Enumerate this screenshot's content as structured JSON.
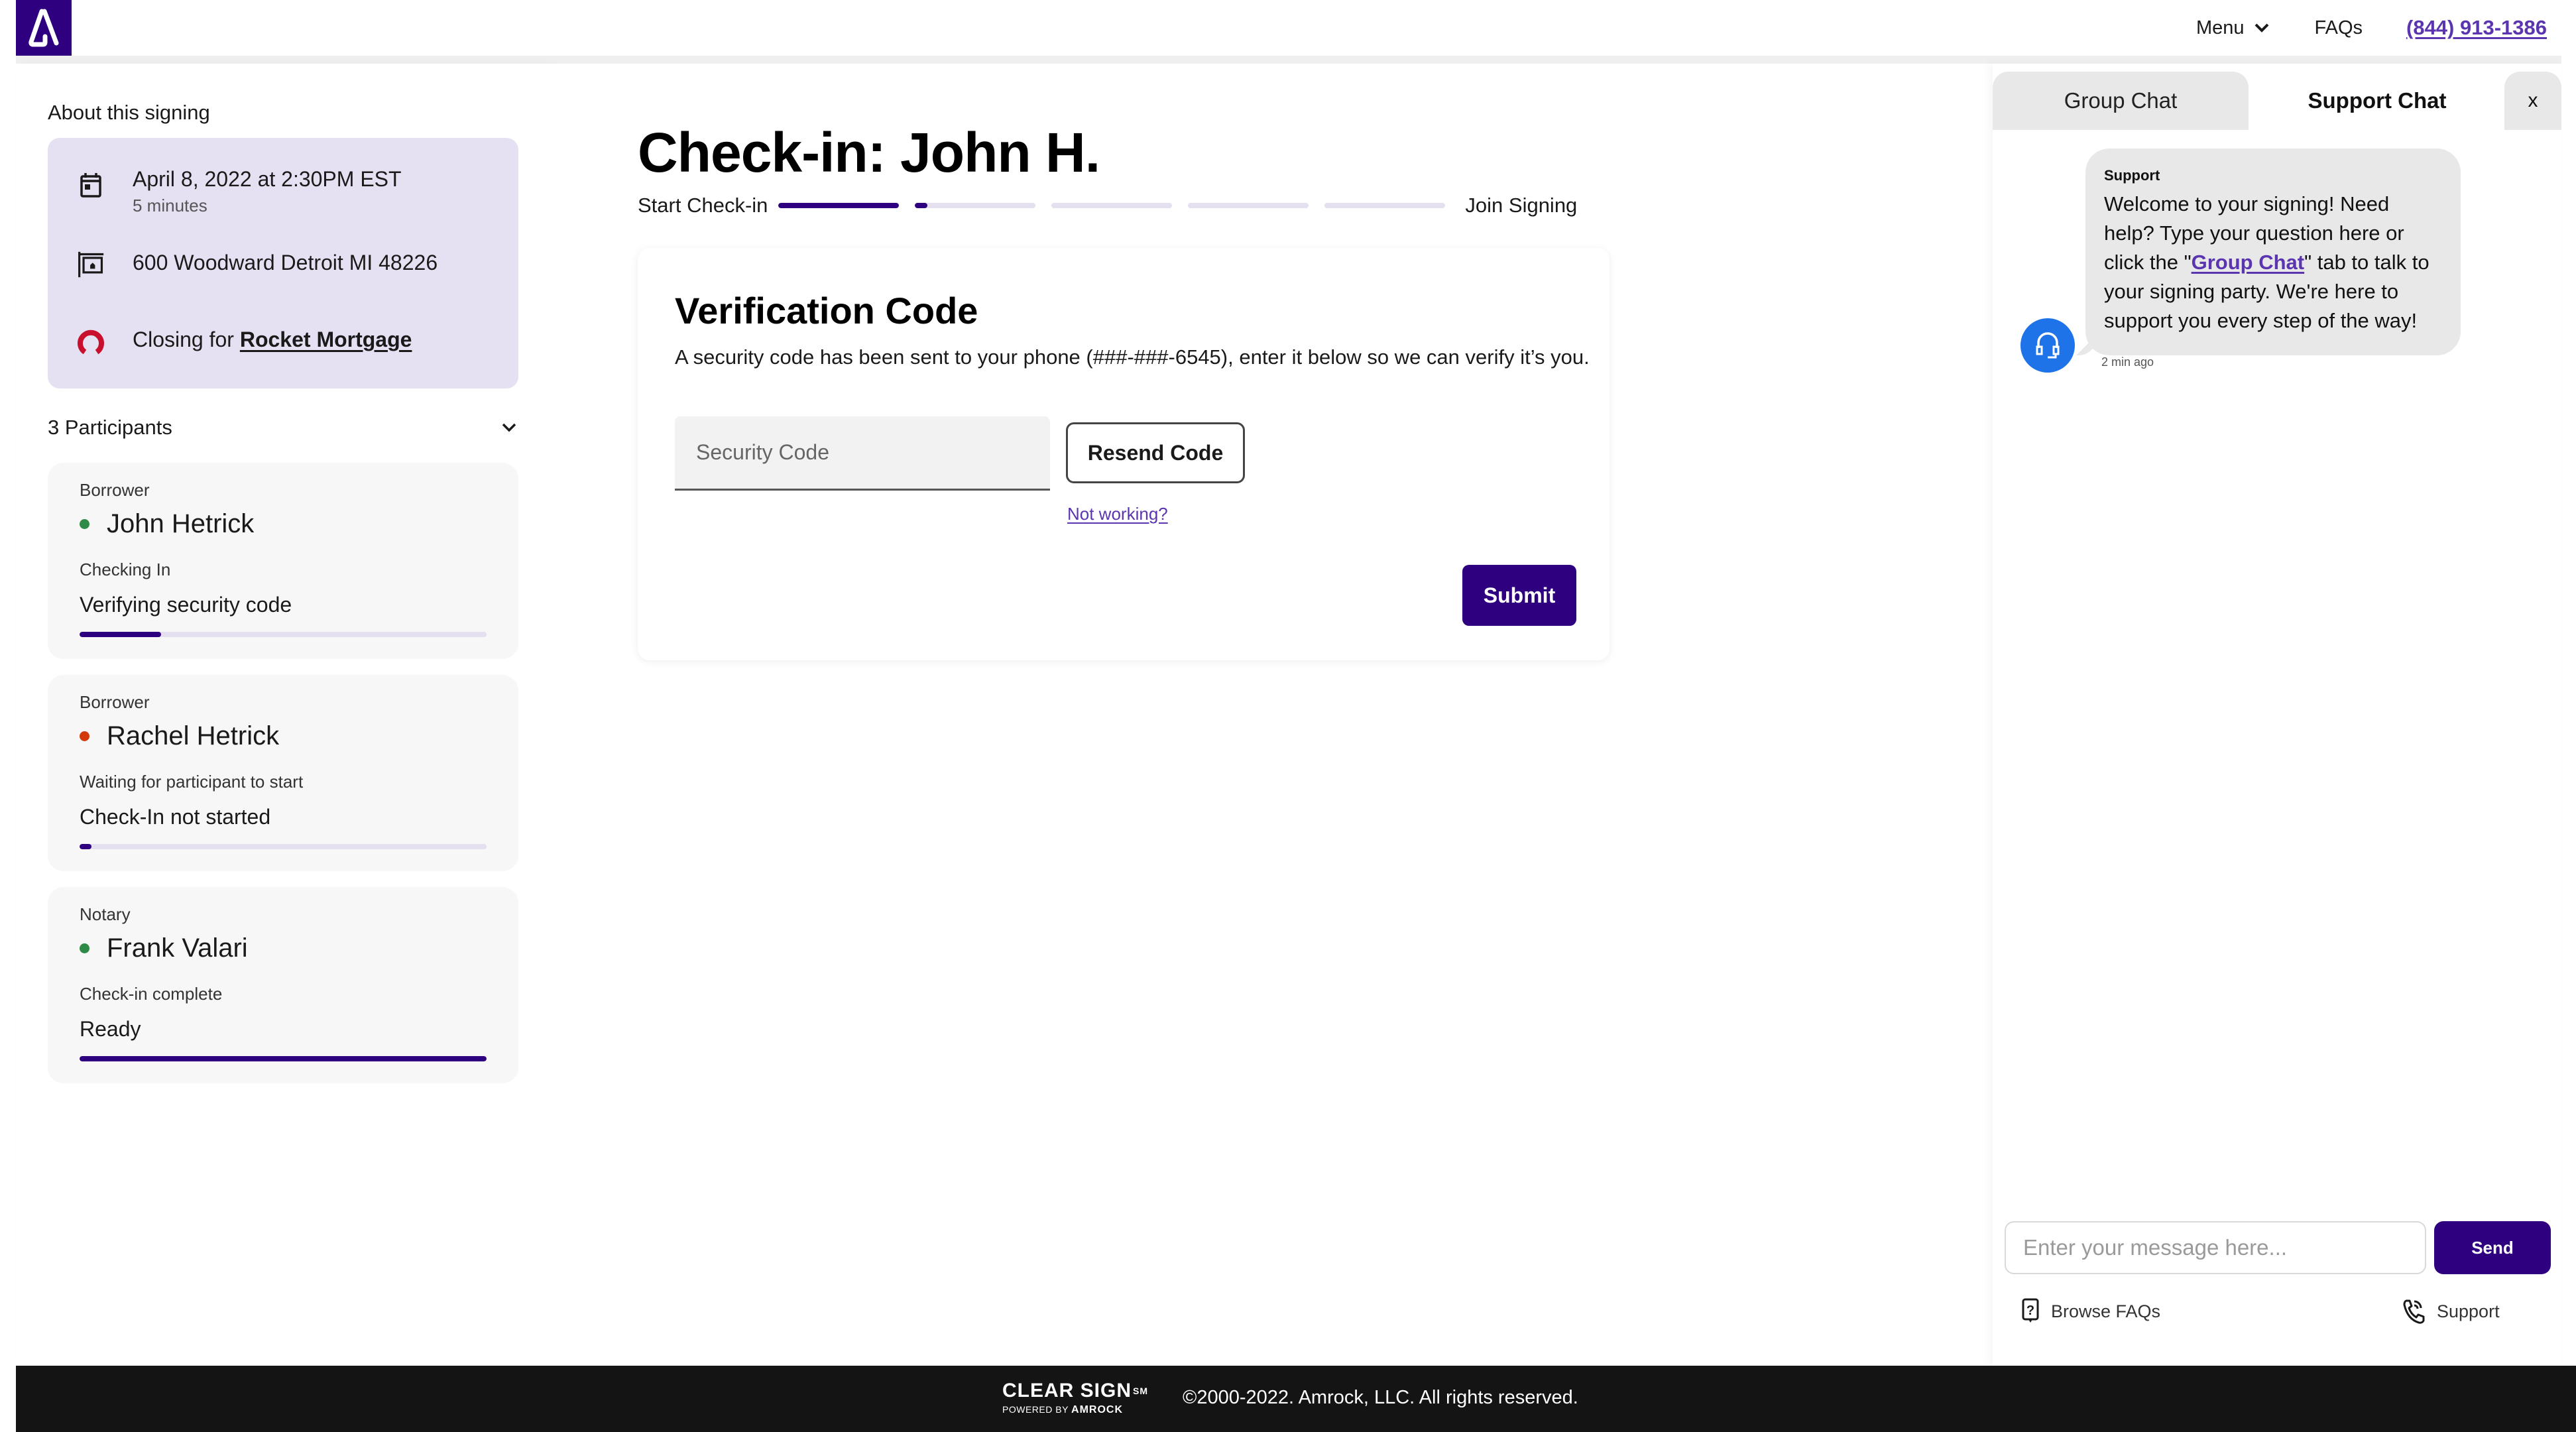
{
  "header": {
    "logo": "amrock-logo",
    "menu_label": "Menu",
    "faqs_label": "FAQs",
    "phone": "(844) 913-1386"
  },
  "sidebar": {
    "about_title": "About this signing",
    "about": {
      "date": "April 8, 2022 at 2:30PM EST",
      "duration": "5 minutes",
      "address": "600 Woodward Detroit MI 48226",
      "closing_prefix": "Closing for ",
      "closing_company": "Rocket Mortgage"
    },
    "participants_label": "3 Participants",
    "participants": [
      {
        "role": "Borrower",
        "name": "John Hetrick",
        "status": "Checking In",
        "step": "Verifying security code",
        "progress": 0.2,
        "dot_color": "#2e8b47"
      },
      {
        "role": "Borrower",
        "name": "Rachel Hetrick",
        "status": "Waiting for participant to start",
        "step": "Check-In not started",
        "progress": 0.03,
        "dot_color": "#d23a0a"
      },
      {
        "role": "Notary",
        "name": "Frank Valari",
        "status": "Check-in complete",
        "step": "Ready",
        "progress": 1.0,
        "dot_color": "#2e8b47"
      }
    ]
  },
  "main": {
    "title": "Check-in: John H.",
    "stepper": {
      "start_label": "Start Check-in",
      "end_label": "Join Signing",
      "segments": [
        1.0,
        0.1,
        0,
        0,
        0
      ]
    },
    "verification": {
      "title": "Verification Code",
      "description": "A security code has been sent to your phone (###-###-6545), enter it below so we can verify it’s you.",
      "input_placeholder": "Security Code",
      "input_value": "",
      "resend_label": "Resend Code",
      "not_working_label": "Not working?",
      "submit_label": "Submit"
    }
  },
  "chat": {
    "tabs": [
      {
        "label": "Group Chat",
        "active": false
      },
      {
        "label": "Support Chat",
        "active": true
      }
    ],
    "close_label": "x",
    "messages": [
      {
        "sender": "Support",
        "text_before": "Welcome to your signing! Need help? Type your question here or click the \"",
        "link_text": "Group Chat",
        "text_after": "\" tab to talk to your signing party. We're here to support you every step of the way!",
        "time": "2 min ago"
      }
    ],
    "input_placeholder": "Enter your message here...",
    "send_label": "Send",
    "browse_faqs_label": "Browse FAQs",
    "support_label": "Support"
  },
  "footer": {
    "brand": "CLEAR SIGN",
    "brand_mark": "SM",
    "powered_by": "POWERED BY",
    "powered_brand": "AMROCK",
    "copyright": "©2000-2022. Amrock, LLC. All rights reserved."
  },
  "colors": {
    "brand_purple": "#2e0080",
    "link_purple": "#5b35b0",
    "about_card_bg": "#e6e1f2",
    "progress_track": "#e4e0f0",
    "support_avatar": "#1f73e8",
    "rocket_red": "#c8102e",
    "footer_bg": "#141414"
  }
}
